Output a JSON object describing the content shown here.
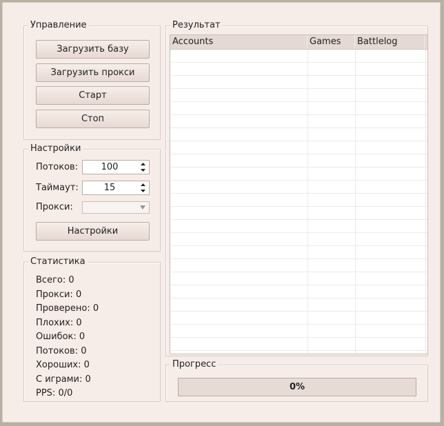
{
  "control": {
    "title": "Управление",
    "load_base": "Загрузить базу",
    "load_proxy": "Загрузить прокси",
    "start": "Старт",
    "stop": "Стоп"
  },
  "settings": {
    "title": "Настройки",
    "threads_label": "Потоков:",
    "threads_value": "100",
    "timeout_label": "Таймаут:",
    "timeout_value": "15",
    "proxy_label": "Прокси:",
    "proxy_value": "",
    "settings_button": "Настройки"
  },
  "stats": {
    "title": "Статистика",
    "items": [
      "Всего: 0",
      "Прокси: 0",
      "Проверено: 0",
      "Плохих: 0",
      "Ошибок: 0",
      "Потоков: 0",
      "Хороших: 0",
      "С играми: 0",
      "PPS: 0/0"
    ]
  },
  "result": {
    "title": "Результат",
    "columns": [
      "Accounts",
      "Games",
      "Battlelog"
    ]
  },
  "progress": {
    "title": "Прогресс",
    "label": "0%",
    "value": 0
  },
  "icons": {
    "spin_arrows": "up-down-arrows-icon",
    "combo_arrow": "chevron-down-icon"
  }
}
